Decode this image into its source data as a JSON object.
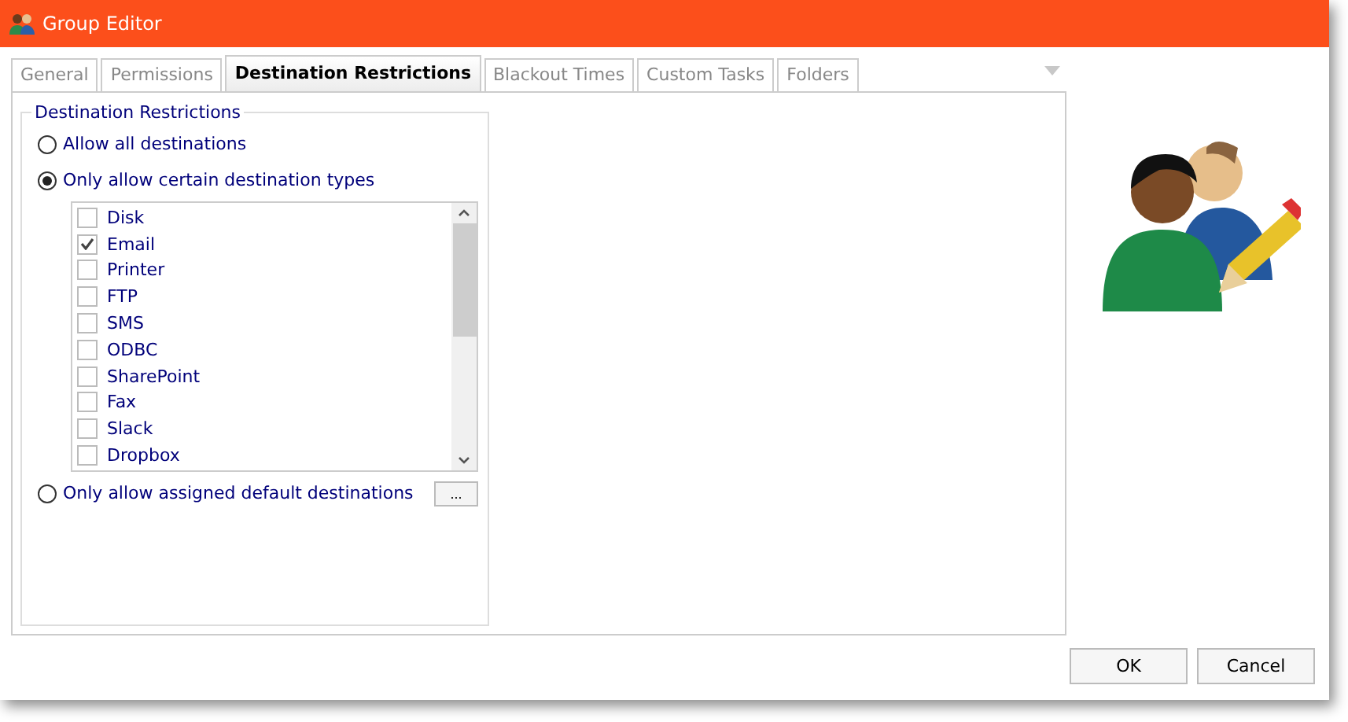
{
  "window": {
    "title": "Group Editor"
  },
  "tabs": [
    {
      "label": "General",
      "selected": false
    },
    {
      "label": "Permissions",
      "selected": false
    },
    {
      "label": "Destination Restrictions",
      "selected": true
    },
    {
      "label": "Blackout Times",
      "selected": false
    },
    {
      "label": "Custom Tasks",
      "selected": false
    },
    {
      "label": "Folders",
      "selected": false
    }
  ],
  "group": {
    "title": "Destination Restrictions",
    "options": [
      {
        "label": "Allow all destinations",
        "selected": false
      },
      {
        "label": "Only allow certain destination types",
        "selected": true
      },
      {
        "label": "Only allow assigned default destinations",
        "selected": false
      }
    ],
    "destination_types": [
      {
        "label": "Disk",
        "checked": false
      },
      {
        "label": "Email",
        "checked": true
      },
      {
        "label": "Printer",
        "checked": false
      },
      {
        "label": "FTP",
        "checked": false
      },
      {
        "label": "SMS",
        "checked": false
      },
      {
        "label": "ODBC",
        "checked": false
      },
      {
        "label": "SharePoint",
        "checked": false
      },
      {
        "label": "Fax",
        "checked": false
      },
      {
        "label": "Slack",
        "checked": false
      },
      {
        "label": "Dropbox",
        "checked": false
      }
    ],
    "browse_button": "..."
  },
  "buttons": [
    "OK",
    "Cancel"
  ]
}
